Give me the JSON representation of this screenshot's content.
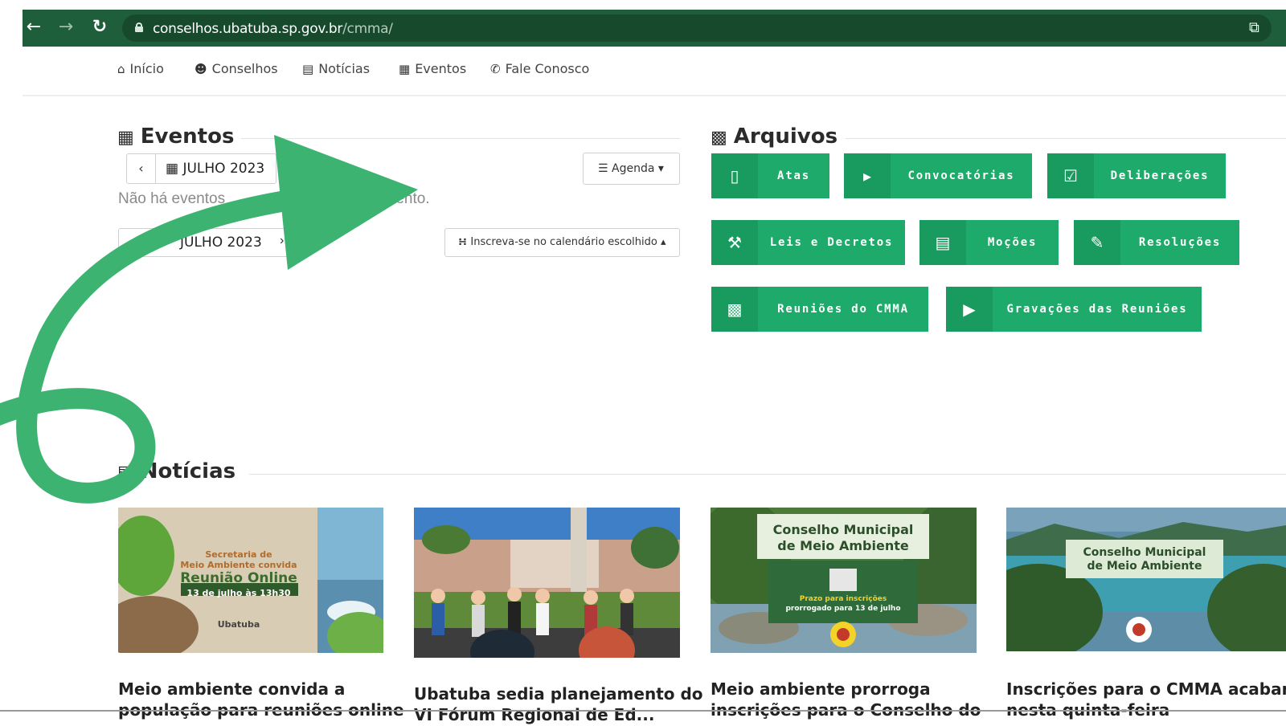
{
  "browser": {
    "url_host": "conselhos.ubatuba.sp.gov.br",
    "url_path": "/cmma/"
  },
  "nav": {
    "items": [
      {
        "icon": "home-icon",
        "label": "Início"
      },
      {
        "icon": "users-icon",
        "label": "Conselhos"
      },
      {
        "icon": "newspaper-icon",
        "label": "Notícias"
      },
      {
        "icon": "calendar-icon",
        "label": "Eventos"
      },
      {
        "icon": "phone-icon",
        "label": "Fale Conosco"
      }
    ]
  },
  "eventos": {
    "title": "Eventos",
    "month_label": "JULHO 2023",
    "agenda_label": "Agenda",
    "no_events": "Não há eventos",
    "no_events_tail": "momento.",
    "subscribe_label": "Inscreva-se no calendário escolhido"
  },
  "arquivos": {
    "title": "Arquivos",
    "buttons": [
      {
        "label": "Atas",
        "icon": "book-icon"
      },
      {
        "label": "Convocatórias",
        "icon": "megaphone-icon"
      },
      {
        "label": "Deliberações",
        "icon": "check-square-icon"
      },
      {
        "label": "Leis e Decretos",
        "icon": "gavel-icon"
      },
      {
        "label": "Moções",
        "icon": "file-icon"
      },
      {
        "label": "Resoluções",
        "icon": "edit-icon"
      },
      {
        "label": "Reuniões do CMMA",
        "icon": "archive-icon"
      },
      {
        "label": "Gravações das Reuniões",
        "icon": "play-icon"
      }
    ]
  },
  "noticias": {
    "title": "Notícias",
    "items": [
      {
        "image_text": [
          "Secretaria de",
          "Meio Ambiente convida",
          "Reunião Online",
          "13 de julho às 13h30",
          "Ubatuba"
        ],
        "title_lines": [
          "Meio ambiente convida a",
          "população para reuniões online"
        ]
      },
      {
        "image_text": [],
        "title_lines": [
          "Ubatuba sedia planejamento do",
          "VI Fórum Regional de Ed..."
        ]
      },
      {
        "image_text": [
          "Conselho Municipal",
          "de Meio Ambiente",
          "Prazo para inscrições",
          "prorrogado para 13 de julho"
        ],
        "title_lines": [
          "Meio ambiente prorroga",
          "inscrições para o Conselho do"
        ]
      },
      {
        "image_text": [
          "Conselho Municipal",
          "de Meio Ambiente"
        ],
        "title_lines": [
          "Inscrições para o CMMA acabam",
          "nesta quinta-feira"
        ]
      }
    ]
  },
  "colors": {
    "browser_bar": "#1f5e3a",
    "button_green": "#1eaa6b",
    "arrow_green": "#3cb371"
  }
}
